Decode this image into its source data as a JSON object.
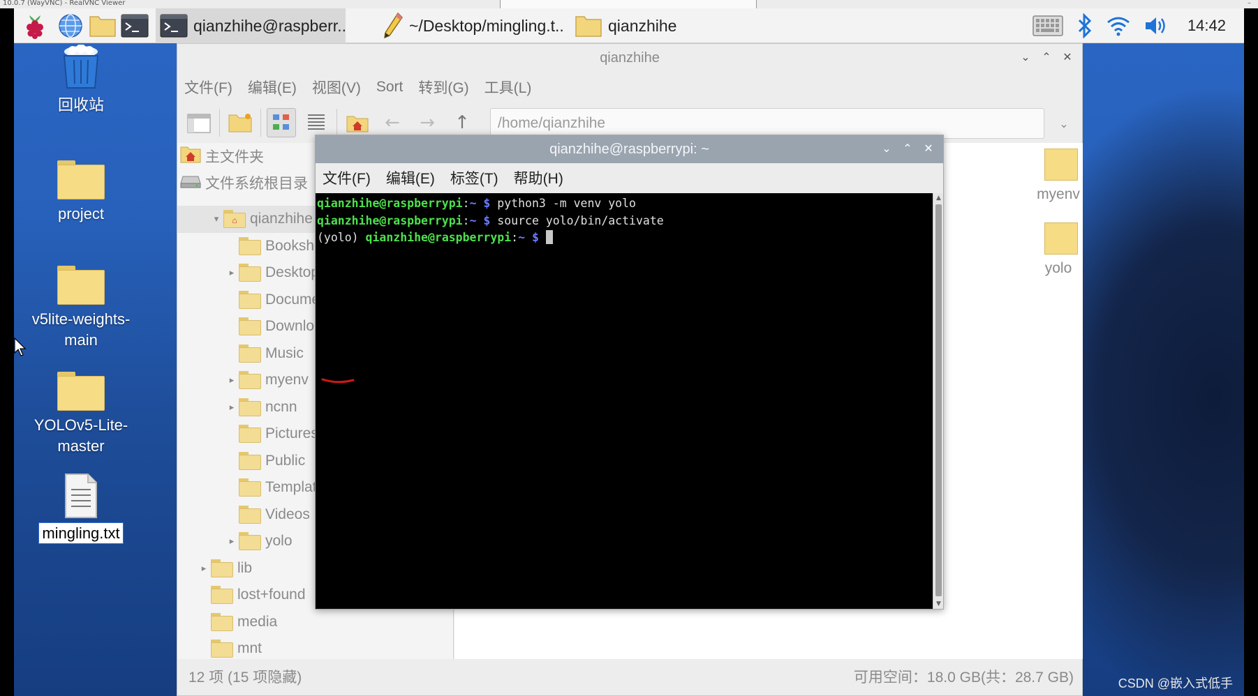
{
  "vnc": {
    "title": "10.0.7 (WayVNC) - RealVNC Viewer",
    "minimize": "–"
  },
  "taskbar": {
    "tasks": [
      {
        "label": "qianzhihe@raspberr..",
        "icon": "terminal-icon"
      },
      {
        "label": "~/Desktop/mingling.t..",
        "icon": "text-editor-icon"
      },
      {
        "label": "qianzhihe",
        "icon": "folder-icon"
      }
    ],
    "clock": "14:42"
  },
  "desktop": {
    "icons": [
      {
        "label": "回收站",
        "icon": "trash-icon"
      },
      {
        "label": "project",
        "icon": "folder-icon"
      },
      {
        "label": "v5lite-weights-main",
        "icon": "folder-icon"
      },
      {
        "label": "YOLOv5-Lite-master",
        "icon": "folder-icon"
      },
      {
        "label": "mingling.txt",
        "icon": "text-file-icon"
      }
    ]
  },
  "file_manager": {
    "title": "qianzhihe",
    "menu": [
      "文件(F)",
      "编辑(E)",
      "视图(V)",
      "Sort",
      "转到(G)",
      "工具(L)"
    ],
    "address": "/home/qianzhihe",
    "places": [
      {
        "label": "主文件夹",
        "icon": "home-icon"
      },
      {
        "label": "文件系统根目录",
        "icon": "drive-icon"
      }
    ],
    "tree": [
      {
        "label": "qianzhihe",
        "level": 1,
        "expanded": true,
        "icon": "home-icon"
      },
      {
        "label": "Bookshelf",
        "level": 2,
        "icon": "folder-icon"
      },
      {
        "label": "Desktop",
        "level": 2,
        "icon": "folder-desktop-icon"
      },
      {
        "label": "Documents",
        "level": 2,
        "icon": "folder-documents-icon"
      },
      {
        "label": "Downloads",
        "level": 2,
        "icon": "folder-downloads-icon"
      },
      {
        "label": "Music",
        "level": 2,
        "icon": "folder-music-icon"
      },
      {
        "label": "myenv",
        "level": 2,
        "icon": "folder-icon"
      },
      {
        "label": "ncnn",
        "level": 2,
        "icon": "folder-icon"
      },
      {
        "label": "Pictures",
        "level": 2,
        "icon": "folder-pictures-icon"
      },
      {
        "label": "Public",
        "level": 2,
        "icon": "folder-public-icon"
      },
      {
        "label": "Templates",
        "level": 2,
        "icon": "folder-templates-icon"
      },
      {
        "label": "Videos",
        "level": 2,
        "icon": "folder-videos-icon"
      },
      {
        "label": "yolo",
        "level": 2,
        "icon": "folder-icon"
      },
      {
        "label": "lib",
        "level": 0,
        "icon": "folder-icon"
      },
      {
        "label": "lost+found",
        "level": 0,
        "icon": "folder-icon"
      },
      {
        "label": "media",
        "level": 0,
        "icon": "folder-icon"
      },
      {
        "label": "mnt",
        "level": 0,
        "icon": "folder-icon"
      }
    ],
    "content_items": [
      {
        "label": "myenv"
      },
      {
        "label": "yolo"
      }
    ],
    "status_left": "12 项 (15 项隐藏)",
    "status_right": "可用空间：18.0 GB(共：28.7 GB)"
  },
  "terminal": {
    "title": "qianzhihe@raspberrypi: ~",
    "menu": [
      "文件(F)",
      "编辑(E)",
      "标签(T)",
      "帮助(H)"
    ],
    "lines": [
      {
        "venv": "",
        "user": "qianzhihe@raspberrypi",
        "path": "~",
        "symbol": "$",
        "cmd": " python3 -m venv yolo"
      },
      {
        "venv": "",
        "user": "qianzhihe@raspberrypi",
        "path": "~",
        "symbol": "$",
        "cmd": " source yolo/bin/activate"
      },
      {
        "venv": "(yolo) ",
        "user": "qianzhihe@raspberrypi",
        "path": "~",
        "symbol": "$",
        "cmd": " "
      }
    ],
    "annotation_color": "#d01818"
  },
  "watermark": "CSDN @嵌入式低手"
}
